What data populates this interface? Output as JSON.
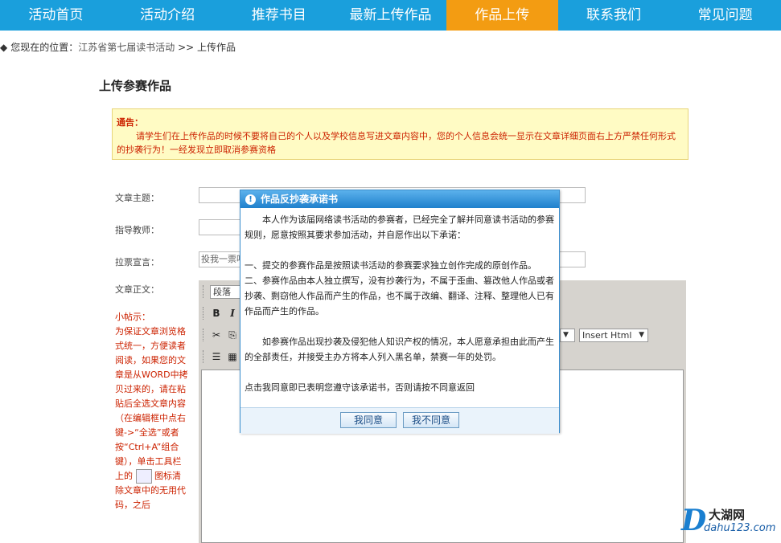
{
  "nav": {
    "items": [
      {
        "label": "活动首页"
      },
      {
        "label": "活动介绍"
      },
      {
        "label": "推荐书目"
      },
      {
        "label": "最新上传作品"
      },
      {
        "label": "作品上传"
      },
      {
        "label": "联系我们"
      },
      {
        "label": "常见问题"
      }
    ],
    "active_index": 4,
    "active_color": "#f39c12",
    "bar_color": "#1a9fdc"
  },
  "breadcrumb": {
    "bullet": "◆",
    "prefix": "您现在的位置：",
    "link": "江苏省第七届读书活动",
    "sep": ">>",
    "current": "上传作品"
  },
  "page_title": "上传参赛作品",
  "notice": {
    "title": "通告：",
    "body": "请学生们在上传作品的时候不要将自己的个人以及学校信息写进文章内容中，您的个人信息会统一显示在文章详细页面右上方严禁任何形式的抄袭行为！一经发现立即取消参赛资格"
  },
  "form": {
    "subject_label": "文章主题：",
    "subject_value": "",
    "teacher_label": "指导教师：",
    "teacher_value": "",
    "slogan_label": "拉票宣言：",
    "slogan_value": "投我一票吧",
    "body_label": "文章正文："
  },
  "tips": {
    "head": "小帖示：",
    "text1": "为保证文章浏览格式统一，方便读者阅读，如果您的文章是从WORD中拷贝过来的，请在粘贴后全选文章内容（在编辑框中点右键->“全选”或者按“Ctrl+A”组合键），单击工具栏上的",
    "text2": "图标清除文章中的无用代码，之后"
  },
  "editor": {
    "paragraph_select": "段落",
    "bold": "B",
    "italic": "I",
    "insert_html": "Insert Html"
  },
  "dialog": {
    "title": "作品反抄袭承诺书",
    "p1": "本人作为该届网络读书活动的参赛者，已经完全了解并同意读书活动的参赛规则，愿意按照其要求参加活动，并自愿作出以下承诺：",
    "p2": "一、提交的参赛作品是按照读书活动的参赛要求独立创作完成的原创作品。",
    "p3": "二、参赛作品由本人独立撰写，没有抄袭行为，不属于歪曲、篡改他人作品或者抄袭、剽窃他人作品而产生的作品，也不属于改编、翻译、注释、整理他人已有作品而产生的作品。",
    "p4": "如参赛作品出现抄袭及侵犯他人知识产权的情况，本人愿意承担由此而产生的全部责任，并接受主办方将本人列入黑名单，禁赛一年的处罚。",
    "p5": "点击我同意即已表明您遵守该承诺书，否则请按不同意返回",
    "agree": "我同意",
    "disagree": "我不同意"
  },
  "watermark": {
    "logo_letter": "D",
    "name": "大湖网",
    "url": "dahu123.com"
  }
}
